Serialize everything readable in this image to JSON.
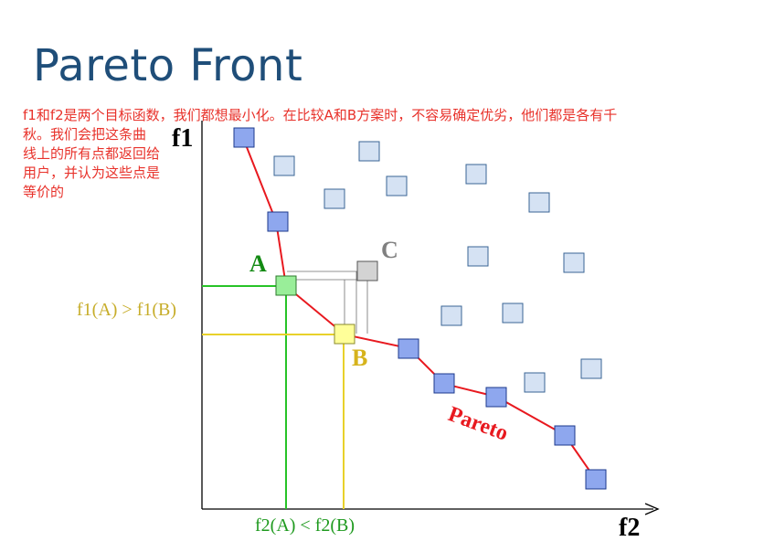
{
  "title": "Pareto Front",
  "note": {
    "lines": [
      "f1和f2是两个目标函数，我们都想最小化。在比较A和B方案时，不容易确定优劣，他们都是各有千",
      "秋。我们会把这条曲",
      "线上的所有点都返回给",
      "用户，并认为这些点是",
      "等价的"
    ]
  },
  "axes": {
    "y_label": "f1",
    "x_label": "f2"
  },
  "labels": {
    "point_a": "A",
    "point_b": "B",
    "point_c": "C",
    "pareto": "Pareto",
    "f1_compare": "f1(A) > f1(B)",
    "f2_compare": "f2(A) < f2(B)"
  },
  "colors": {
    "title": "#1f4e79",
    "note": "#e8322b",
    "pareto_curve": "#e8191f",
    "pareto_point": "#8ea7ee",
    "dominated_point": "#d5e2f3",
    "point_a": "#99ee99",
    "point_b": "#ffff99",
    "point_c": "#d3d3d3",
    "guide_a": "#27c327",
    "guide_b": "#e8d12a",
    "label_a": "#138a13",
    "label_b": "#d6b31c",
    "label_c": "#808080"
  }
}
